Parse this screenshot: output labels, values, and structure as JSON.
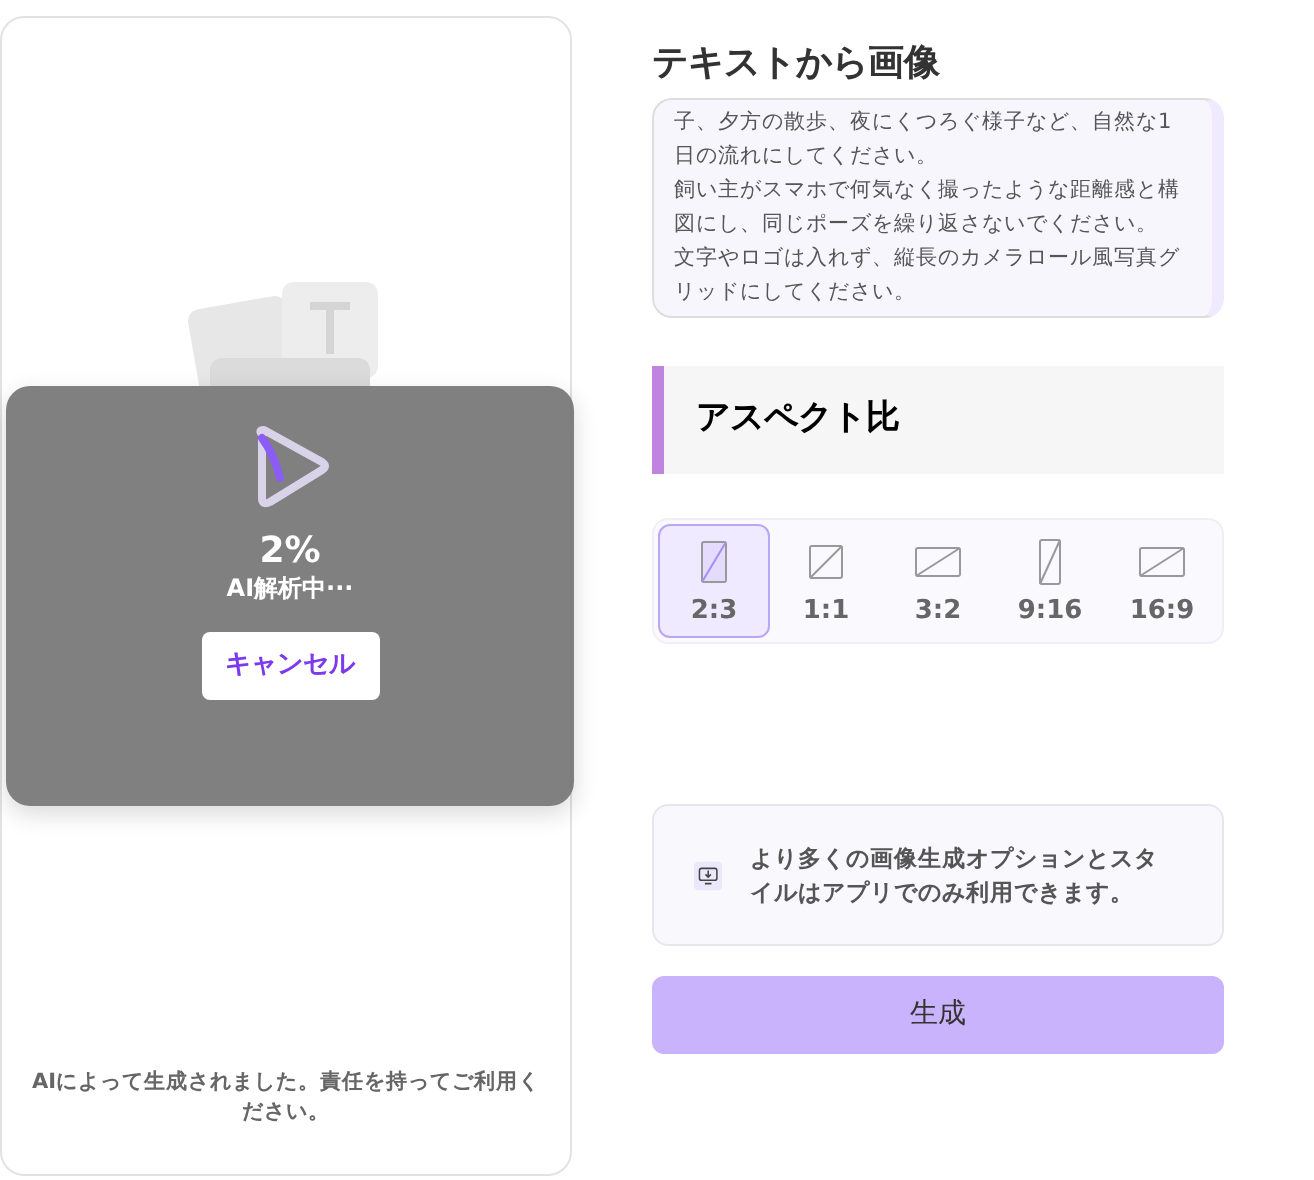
{
  "preview": {
    "progress": {
      "percent": "2%",
      "status": "AI解析中···",
      "cancel_button": "キャンセル"
    },
    "disclaimer": "AIによって生成されました。責任を持ってご利用ください。"
  },
  "title": "テキストから画像",
  "prompt": {
    "lines": [
      "子、夕方の散歩、夜にくつろぐ様子など、自然な1日の流れにしてください。",
      "飼い主がスマホで何気なく撮ったような距離感と構図にし、同じポーズを繰り返さないでください。",
      "文字やロゴは入れず、縦長のカメラロール風写真グリッドにしてください。"
    ]
  },
  "aspect_section": {
    "title": "アスペクト比"
  },
  "aspect_ratios": [
    {
      "label": "2:3",
      "selected": true
    },
    {
      "label": "1:1",
      "selected": false
    },
    {
      "label": "3:2",
      "selected": false
    },
    {
      "label": "9:16",
      "selected": false
    },
    {
      "label": "16:9",
      "selected": false
    }
  ],
  "app_notice": "より多くの画像生成オプションとスタイルはアプリでのみ利用できます。",
  "generate_button": "生成"
}
